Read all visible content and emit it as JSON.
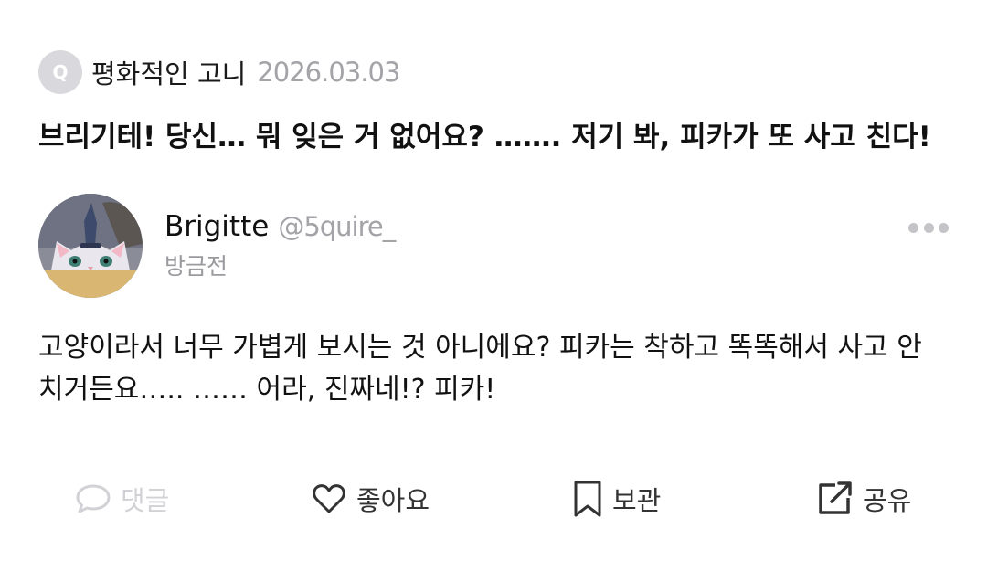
{
  "question": {
    "badge": "Q",
    "author": "평화적인 고니",
    "date": "2026.03.03",
    "text": "브리기테! 당신… 뭐 잊은 거 없어요? ……. 저기 봐, 피카가 또 사고 친다!"
  },
  "answer": {
    "name": "Brigitte",
    "handle": "@5quire_",
    "time": "방금전",
    "text": "고양이라서 너무 가볍게 보시는 것 아니에요? 피카는 착하고 똑똑해서 사고 안 치거든요….. …… 어라, 진짜네!? 피카!"
  },
  "actions": {
    "comment": "댓글",
    "like": "좋아요",
    "save": "보관",
    "share": "공유"
  },
  "icons": {
    "comment": "speech-bubble-icon",
    "like": "heart-icon",
    "save": "bookmark-icon",
    "share": "share-icon",
    "more": "more-dots-icon"
  },
  "colors": {
    "muted": "#a3a3a8",
    "disabled": "#d2d2d6",
    "text": "#111111"
  }
}
